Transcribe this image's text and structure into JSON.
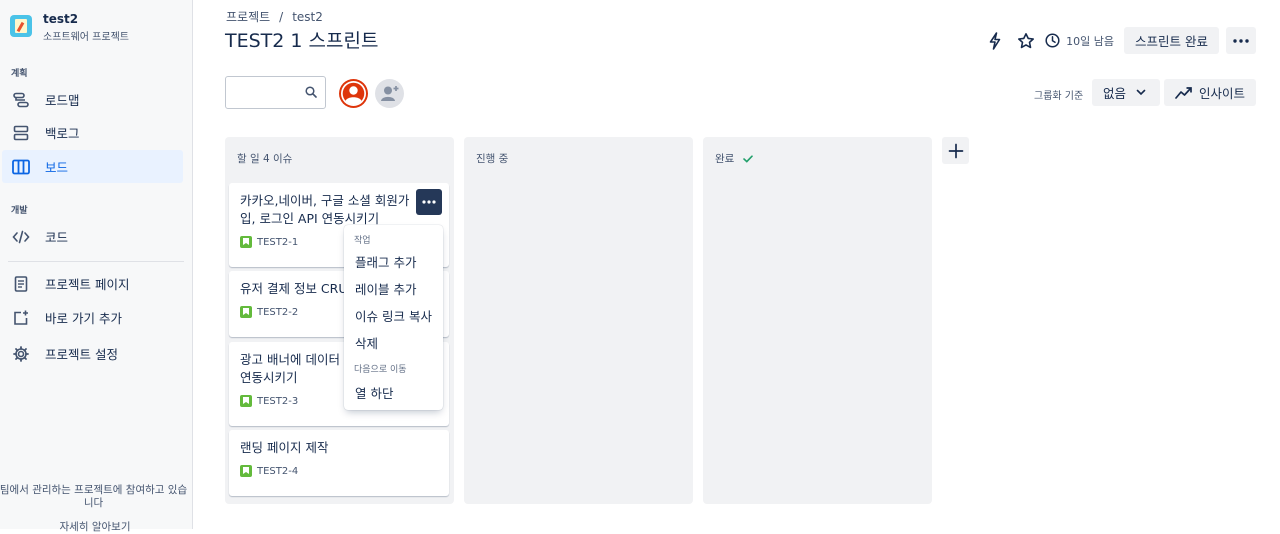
{
  "sidebar": {
    "project_name": "test2",
    "project_type": "소프트웨어 프로젝트",
    "planning_label": "계획",
    "dev_label": "개발",
    "items": {
      "roadmap": "로드맵",
      "backlog": "백로그",
      "board": "보드",
      "code": "코드",
      "project_pages": "프로젝트 페이지",
      "add_shortcut": "바로 가기 추가",
      "project_settings": "프로젝트 설정"
    },
    "promo_text": "팀에서 관리하는 프로젝트에 참여하고 있습니다",
    "promo_link": "자세히 알아보기"
  },
  "header": {
    "breadcrumb": [
      "프로젝트",
      "test2"
    ],
    "title": "TEST2 1 스프린트",
    "days_left": "10일 남음",
    "complete_sprint": "스프린트 완료"
  },
  "filters": {
    "search_placeholder": "",
    "group_by_label": "그룹화 기준",
    "group_by_value": "없음",
    "insights": "인사이트"
  },
  "columns": [
    {
      "title": "할 일 4 이슈"
    },
    {
      "title": "진행 중"
    },
    {
      "title": "완료"
    }
  ],
  "cards": [
    {
      "title": "카카오,네이버, 구글 소셜 회원가입, 로그인 API 연동시키기",
      "key": "TEST2-1"
    },
    {
      "title": "유저 결제 정보 CRUD",
      "key": "TEST2-2"
    },
    {
      "title": "광고 배너에 데이터 연동시키기",
      "key": "TEST2-3"
    },
    {
      "title": "랜딩 페이지 제작",
      "key": "TEST2-4"
    }
  ],
  "menu": {
    "group_actions": "작업",
    "add_flag": "플래그 추가",
    "add_label": "레이블 추가",
    "copy_link": "이슈 링크 복사",
    "delete": "삭제",
    "group_move": "다음으로 이동",
    "column_bottom": "열 하단"
  },
  "colors": {
    "accent": "#0c66e4",
    "story": "#63ba3c",
    "done_check": "#22a06b"
  }
}
